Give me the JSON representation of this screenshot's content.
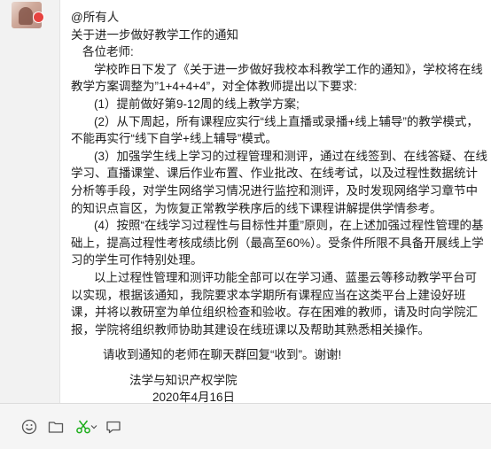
{
  "message": {
    "mention": "@所有人",
    "subject": "关于进一步做好教学工作的通知",
    "greeting": "各位老师:",
    "para1": "学校昨日下发了《关于进一步做好我校本科教学工作的通知》，学校将在线教学方案调整为”1+4+4+4”，对全体教师提出以下要求:",
    "item1": "(1）提前做好第9-12周的线上教学方案;",
    "item2": "(2）从下周起，所有课程应实行“线上直播或录播+线上辅导”的教学模式，不能再实行“线下自学+线上辅导”模式。",
    "item3": "(3）加强学生线上学习的过程管理和测评，通过在线签到、在线答疑、在线学习、直播课堂、课后作业布置、作业批改、在线考试，以及过程性数据统计分析等手段，对学生网络学习情况进行监控和测评，及时发现网络学习章节中的知识点盲区，为恢复正常教学秩序后的线下课程讲解提供学情参考。",
    "item4": "(4）按照“在线学习过程性与目标性并重”原则，在上述加强过程性管理的基础上，提高过程性考核成绩比例（最高至60%）。受条件所限不具备开展线上学习的学生可作特别处理。",
    "para2": "以上过程性管理和测评功能全部可以在学习通、蓝墨云等移动教学平台可以实现，根据该通知，我院要求本学期所有课程应当在这类平台上建设好班课，并将以教研室为单位组织检查和验收。存在困难的教师，请及时向学院汇报，学院将组织教师协助其建设在线班课以及帮助其熟悉相关操作。",
    "closing": "请收到通知的老师在聊天群回复“收到”。谢谢!",
    "signature": "法学与知识产权学院",
    "date": "2020年4月16日"
  },
  "toolbar": {
    "icons": [
      "emoji-icon",
      "folder-icon",
      "scissors-icon",
      "chevron-down-icon",
      "chat-bubble-icon"
    ]
  },
  "colors": {
    "bubble_bg": "#ffffff",
    "chat_bg": "#f2f2f2",
    "scissors_green": "#1aad19",
    "badge_red": "#e64340"
  }
}
